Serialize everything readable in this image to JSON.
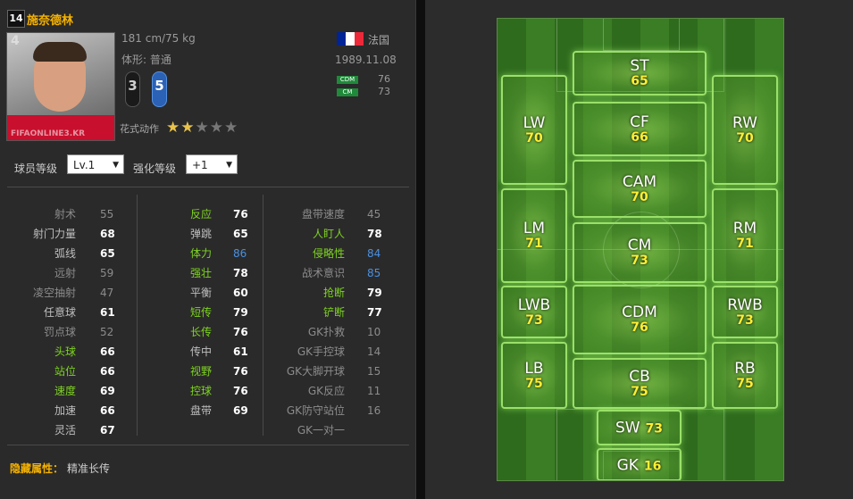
{
  "player": {
    "season_badge": "14",
    "name": "施奈德林",
    "number": "4",
    "photo_watermark": "FIFAONLINE3.KR",
    "height_weight": "181 cm/75 kg",
    "body_type": "体形: 普通",
    "weak_foot": "3",
    "strong_foot": "5",
    "skill_moves_label": "花式动作",
    "skill_stars": 2,
    "skill_stars_max": 5,
    "nation": "法国",
    "birthdate": "1989.11.08",
    "positions": [
      {
        "pos": "CDM",
        "rating": "76"
      },
      {
        "pos": "CM",
        "rating": "73"
      }
    ]
  },
  "controls": {
    "level_label": "球员等级",
    "level_value": "Lv.1",
    "upgrade_label": "强化等级",
    "upgrade_value": "+1"
  },
  "stats": {
    "col1": [
      {
        "label": "射术",
        "value": "55",
        "color": "#8c8c8c",
        "vcolor": "#8c8c8c"
      },
      {
        "label": "射门力量",
        "value": "68",
        "color": "#bfbfbf",
        "vcolor": "#ffffff"
      },
      {
        "label": "弧线",
        "value": "65",
        "color": "#bfbfbf",
        "vcolor": "#ffffff"
      },
      {
        "label": "远射",
        "value": "59",
        "color": "#8c8c8c",
        "vcolor": "#8c8c8c"
      },
      {
        "label": "凌空抽射",
        "value": "47",
        "color": "#8c8c8c",
        "vcolor": "#8c8c8c"
      },
      {
        "label": "任意球",
        "value": "61",
        "color": "#bfbfbf",
        "vcolor": "#ffffff"
      },
      {
        "label": "罚点球",
        "value": "52",
        "color": "#8c8c8c",
        "vcolor": "#8c8c8c"
      },
      {
        "label": "头球",
        "value": "66",
        "color": "#7ed321",
        "vcolor": "#ffffff"
      },
      {
        "label": "站位",
        "value": "66",
        "color": "#7ed321",
        "vcolor": "#ffffff"
      },
      {
        "label": "速度",
        "value": "69",
        "color": "#7ed321",
        "vcolor": "#ffffff"
      },
      {
        "label": "加速",
        "value": "66",
        "color": "#bfbfbf",
        "vcolor": "#ffffff"
      },
      {
        "label": "灵活",
        "value": "67",
        "color": "#bfbfbf",
        "vcolor": "#ffffff"
      }
    ],
    "col2": [
      {
        "label": "反应",
        "value": "76",
        "color": "#7ed321",
        "vcolor": "#ffffff"
      },
      {
        "label": "弹跳",
        "value": "65",
        "color": "#bfbfbf",
        "vcolor": "#ffffff"
      },
      {
        "label": "体力",
        "value": "86",
        "color": "#7ed321",
        "vcolor": "#4a90e2"
      },
      {
        "label": "强壮",
        "value": "78",
        "color": "#7ed321",
        "vcolor": "#ffffff"
      },
      {
        "label": "平衡",
        "value": "60",
        "color": "#bfbfbf",
        "vcolor": "#ffffff"
      },
      {
        "label": "短传",
        "value": "79",
        "color": "#7ed321",
        "vcolor": "#ffffff"
      },
      {
        "label": "长传",
        "value": "76",
        "color": "#7ed321",
        "vcolor": "#ffffff"
      },
      {
        "label": "传中",
        "value": "61",
        "color": "#bfbfbf",
        "vcolor": "#ffffff"
      },
      {
        "label": "视野",
        "value": "76",
        "color": "#7ed321",
        "vcolor": "#ffffff"
      },
      {
        "label": "控球",
        "value": "76",
        "color": "#7ed321",
        "vcolor": "#ffffff"
      },
      {
        "label": "盘带",
        "value": "69",
        "color": "#bfbfbf",
        "vcolor": "#ffffff"
      }
    ],
    "col3": [
      {
        "label": "盘带速度",
        "value": "45",
        "color": "#8c8c8c",
        "vcolor": "#8c8c8c"
      },
      {
        "label": "人盯人",
        "value": "78",
        "color": "#7ed321",
        "vcolor": "#ffffff"
      },
      {
        "label": "侵略性",
        "value": "84",
        "color": "#7ed321",
        "vcolor": "#4a90e2"
      },
      {
        "label": "战术意识",
        "value": "85",
        "color": "#8c8c8c",
        "vcolor": "#4a90e2"
      },
      {
        "label": "抢断",
        "value": "79",
        "color": "#7ed321",
        "vcolor": "#ffffff"
      },
      {
        "label": "铲断",
        "value": "77",
        "color": "#7ed321",
        "vcolor": "#ffffff"
      },
      {
        "label": "GK扑救",
        "value": "10",
        "color": "#8c8c8c",
        "vcolor": "#8c8c8c"
      },
      {
        "label": "GK手控球",
        "value": "14",
        "color": "#8c8c8c",
        "vcolor": "#8c8c8c"
      },
      {
        "label": "GK大脚开球",
        "value": "15",
        "color": "#8c8c8c",
        "vcolor": "#8c8c8c"
      },
      {
        "label": "GK反应",
        "value": "11",
        "color": "#8c8c8c",
        "vcolor": "#8c8c8c"
      },
      {
        "label": "GK防守站位",
        "value": "16",
        "color": "#8c8c8c",
        "vcolor": "#8c8c8c"
      },
      {
        "label": "GK一对一",
        "value": "",
        "color": "#8c8c8c",
        "vcolor": "#8c8c8c"
      }
    ]
  },
  "hidden_traits": {
    "label": "隐藏属性：",
    "value": "精准长传"
  },
  "pitch": [
    {
      "pos": "ST",
      "rating": "65"
    },
    {
      "pos": "LW",
      "rating": "70"
    },
    {
      "pos": "CF",
      "rating": "66"
    },
    {
      "pos": "RW",
      "rating": "70"
    },
    {
      "pos": "CAM",
      "rating": "70"
    },
    {
      "pos": "LM",
      "rating": "71"
    },
    {
      "pos": "CM",
      "rating": "73"
    },
    {
      "pos": "RM",
      "rating": "71"
    },
    {
      "pos": "LWB",
      "rating": "73"
    },
    {
      "pos": "CDM",
      "rating": "76"
    },
    {
      "pos": "RWB",
      "rating": "73"
    },
    {
      "pos": "LB",
      "rating": "75"
    },
    {
      "pos": "CB",
      "rating": "75"
    },
    {
      "pos": "RB",
      "rating": "75"
    },
    {
      "pos": "SW",
      "rating": "73"
    },
    {
      "pos": "GK",
      "rating": "16"
    }
  ],
  "colors": {
    "name_gold": "#f5b200",
    "stat_green": "#7ed321",
    "stat_blue": "#4a90e2",
    "rating_yellow": "#ffee33",
    "star_gold": "#e8c24a",
    "flag": [
      "#002395",
      "#ffffff",
      "#ed2939"
    ]
  }
}
